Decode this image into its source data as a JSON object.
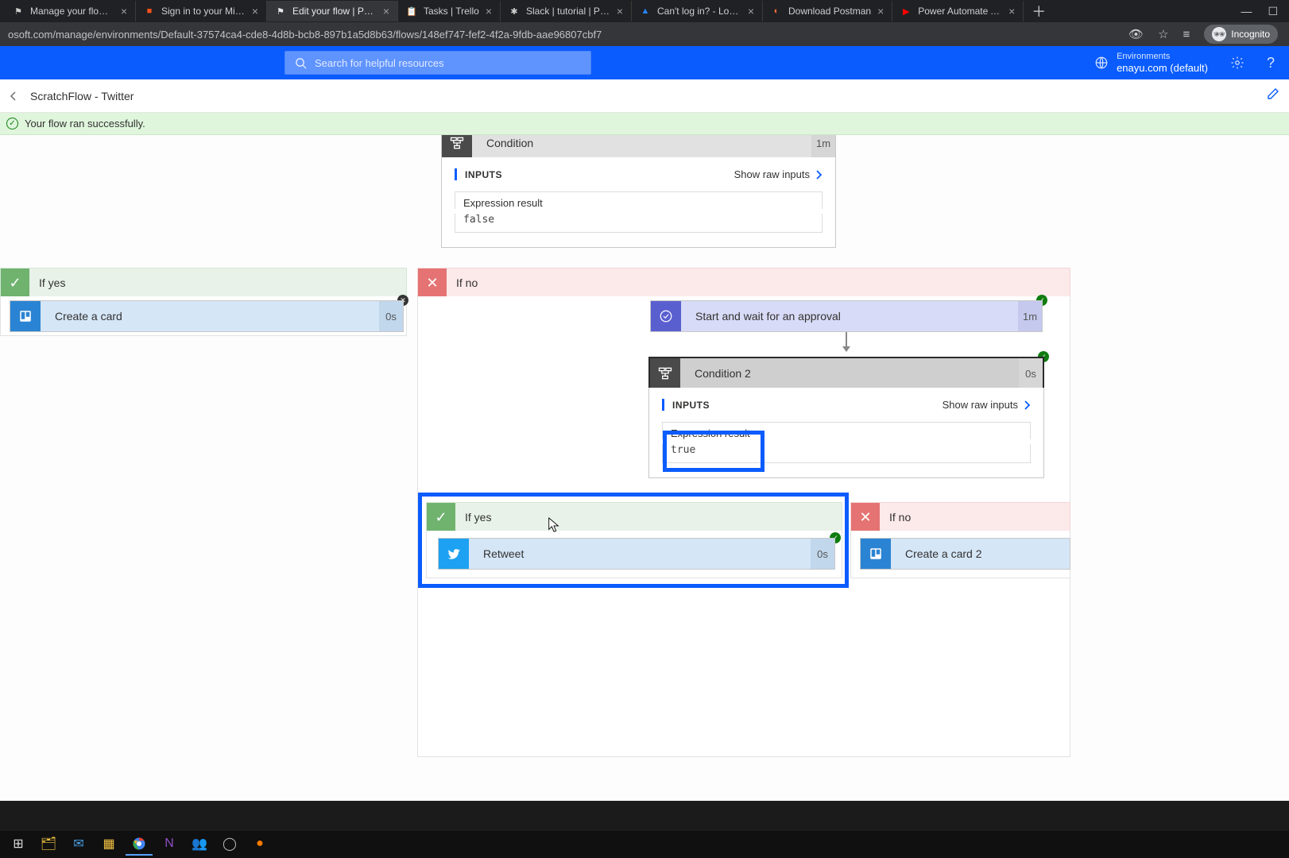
{
  "browser": {
    "tabs": [
      {
        "title": "Manage your flows | M",
        "fav": "⚑"
      },
      {
        "title": "Sign in to your Microso",
        "fav": "■"
      },
      {
        "title": "Edit your flow | Power ",
        "fav": "⚑"
      },
      {
        "title": "Tasks | Trello",
        "fav": "📋"
      },
      {
        "title": "Slack | tutorial | Power",
        "fav": "✱"
      },
      {
        "title": "Can't log in? - Log in w",
        "fav": "▲"
      },
      {
        "title": "Download Postman",
        "fav": "◐"
      },
      {
        "title": "Power Automate Appr",
        "fav": "▶"
      }
    ],
    "url": "osoft.com/manage/environments/Default-37574ca4-cde8-4d8b-bcb8-897b1a5d8b63/flows/148ef747-fef2-4f2a-9fdb-aae96807cbf7",
    "incognito_label": "Incognito"
  },
  "header": {
    "search_placeholder": "Search for helpful resources",
    "env_label": "Environments",
    "env_value": "enayu.com (default)"
  },
  "breadcrumb": {
    "title": "ScratchFlow - Twitter"
  },
  "banner": {
    "text": "Your flow ran successfully."
  },
  "canvas": {
    "condition1": {
      "title": "Condition",
      "duration": "1m",
      "inputs_label": "INPUTS",
      "raw_link": "Show raw inputs",
      "expr_label": "Expression result",
      "expr_value": "false"
    },
    "branch_yes_1": "If yes",
    "branch_no_1": "If no",
    "create_card": {
      "label": "Create a card",
      "duration": "0s"
    },
    "approval": {
      "label": "Start and wait for an approval",
      "duration": "1m"
    },
    "condition2": {
      "title": "Condition 2",
      "duration": "0s",
      "inputs_label": "INPUTS",
      "raw_link": "Show raw inputs",
      "expr_label": "Expression result",
      "expr_value": "true"
    },
    "branch_yes_2": "If yes",
    "branch_no_2": "If no",
    "retweet": {
      "label": "Retweet",
      "duration": "0s"
    },
    "create_card2": {
      "label": "Create a card 2"
    }
  }
}
